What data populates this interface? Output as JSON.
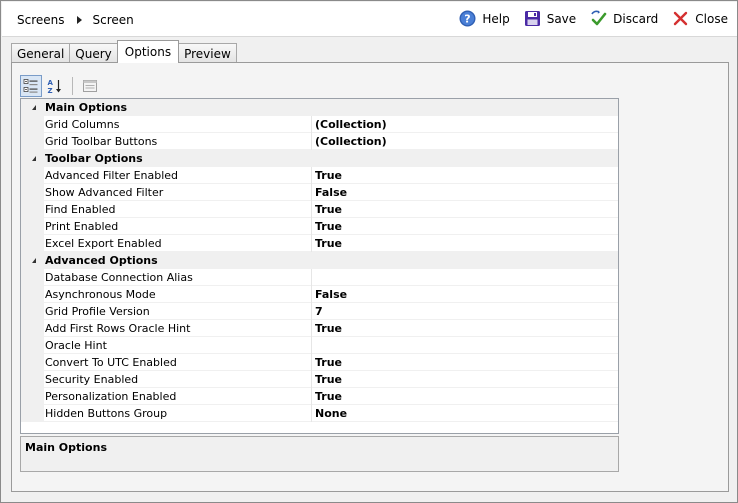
{
  "breadcrumb": {
    "root": "Screens",
    "current": "Screen"
  },
  "actions": {
    "help": "Help",
    "save": "Save",
    "discard": "Discard",
    "close": "Close"
  },
  "colors": {
    "help": "#2f5fb3",
    "save": "#4a2aa5",
    "discard_check": "#3b9a2c",
    "close": "#d43030"
  },
  "icons": {
    "categorized": "categorized-view-icon",
    "alphabetical": "sort-alphabetical-icon",
    "property_pages": "property-pages-icon"
  },
  "tabs": [
    {
      "label": "General",
      "active": false
    },
    {
      "label": "Query",
      "active": false
    },
    {
      "label": "Options",
      "active": true
    },
    {
      "label": "Preview",
      "active": false
    }
  ],
  "categories": [
    {
      "name": "Main Options",
      "properties": [
        {
          "name": "Grid Columns",
          "value": "(Collection)"
        },
        {
          "name": "Grid Toolbar Buttons",
          "value": "(Collection)"
        }
      ]
    },
    {
      "name": "Toolbar Options",
      "properties": [
        {
          "name": "Advanced Filter Enabled",
          "value": "True"
        },
        {
          "name": "Show Advanced Filter",
          "value": "False"
        },
        {
          "name": "Find Enabled",
          "value": "True"
        },
        {
          "name": "Print Enabled",
          "value": "True"
        },
        {
          "name": "Excel Export Enabled",
          "value": "True"
        }
      ]
    },
    {
      "name": "Advanced Options",
      "properties": [
        {
          "name": "Database Connection Alias",
          "value": ""
        },
        {
          "name": "Asynchronous Mode",
          "value": "False"
        },
        {
          "name": "Grid Profile Version",
          "value": "7"
        },
        {
          "name": "Add First Rows Oracle Hint",
          "value": "True"
        },
        {
          "name": "Oracle Hint",
          "value": ""
        },
        {
          "name": "Convert To UTC Enabled",
          "value": "True"
        },
        {
          "name": "Security Enabled",
          "value": "True"
        },
        {
          "name": "Personalization Enabled",
          "value": "True"
        },
        {
          "name": "Hidden Buttons Group",
          "value": "None"
        }
      ]
    }
  ],
  "description": {
    "title": "Main Options"
  }
}
